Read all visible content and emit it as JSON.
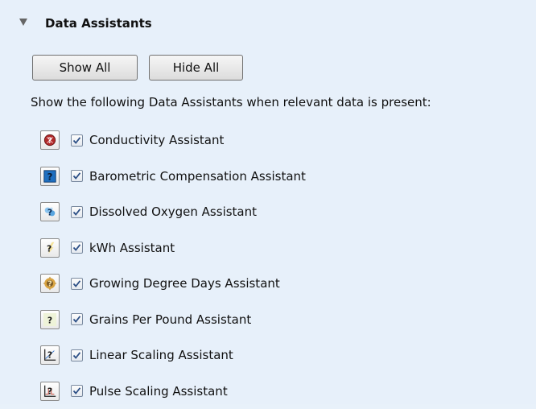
{
  "section": {
    "title": "Data Assistants",
    "expanded": true
  },
  "buttons": {
    "show_all": "Show All",
    "hide_all": "Hide All"
  },
  "intro_text": "Show the following Data Assistants when relevant data is present:",
  "assistants": [
    {
      "label": "Conductivity Assistant",
      "icon": "conductivity-icon",
      "checked": true
    },
    {
      "label": "Barometric Compensation Assistant",
      "icon": "barometric-icon",
      "checked": true
    },
    {
      "label": "Dissolved Oxygen Assistant",
      "icon": "dissolved-oxygen-icon",
      "checked": true
    },
    {
      "label": "kWh Assistant",
      "icon": "kwh-icon",
      "checked": true
    },
    {
      "label": "Growing Degree Days Assistant",
      "icon": "growing-degree-days-icon",
      "checked": true
    },
    {
      "label": "Grains Per Pound Assistant",
      "icon": "grains-per-pound-icon",
      "checked": true
    },
    {
      "label": "Linear Scaling Assistant",
      "icon": "linear-scaling-icon",
      "checked": true
    },
    {
      "label": "Pulse Scaling Assistant",
      "icon": "pulse-scaling-icon",
      "checked": true
    }
  ],
  "colors": {
    "panel_background": "#e7f0fa",
    "checkmark": "#2c4f86"
  }
}
